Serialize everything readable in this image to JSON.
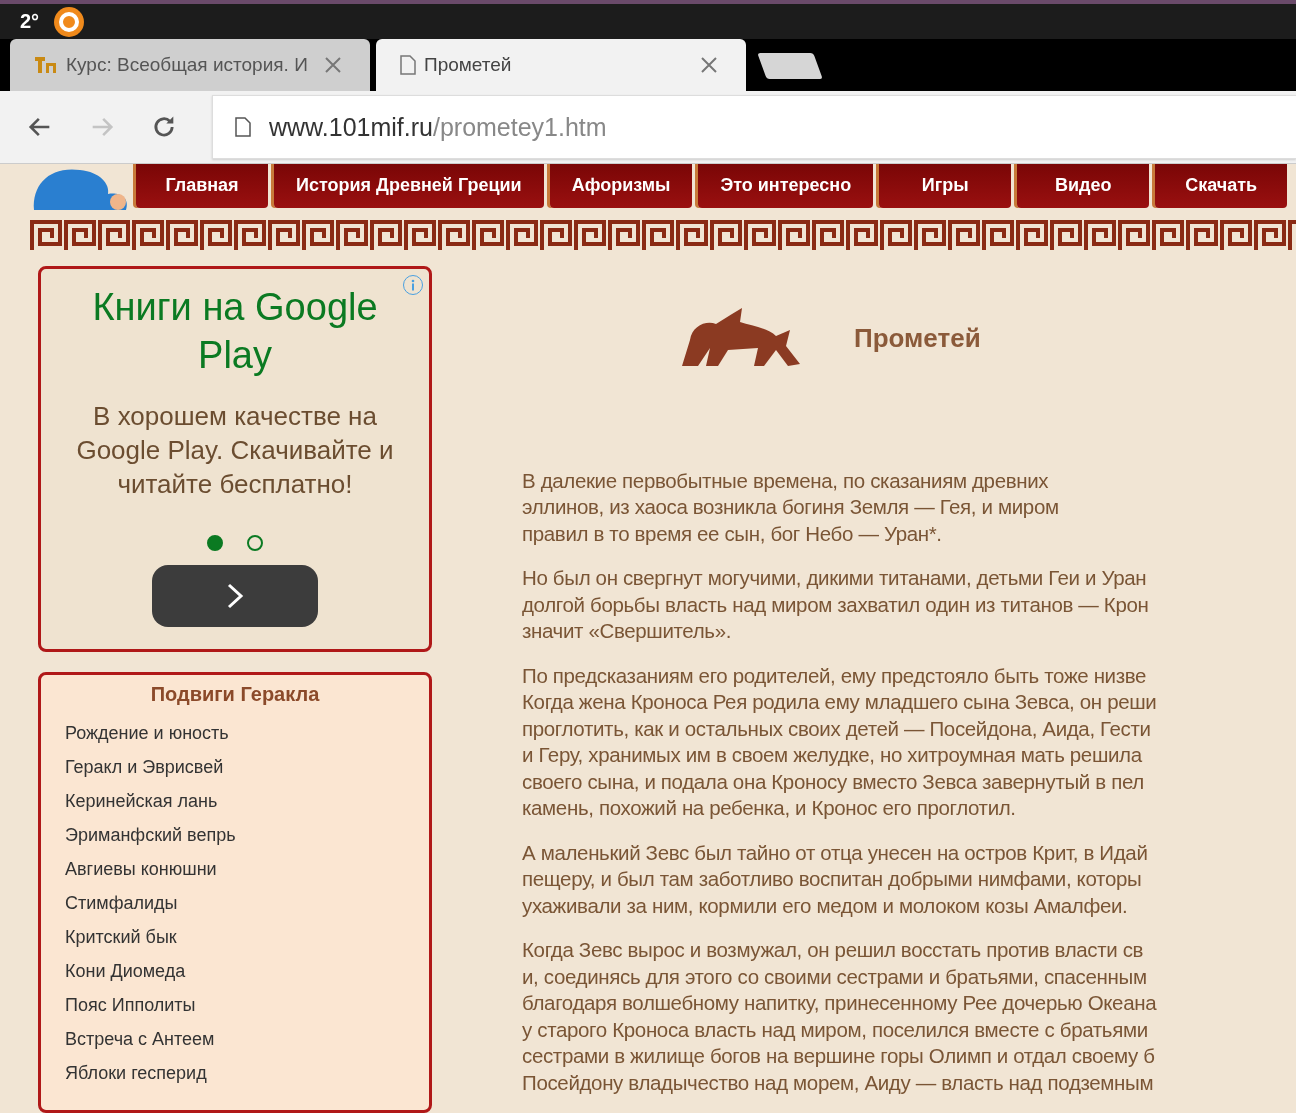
{
  "status_bar": {
    "temperature": "2°"
  },
  "tabs": [
    {
      "title": "Курс: Всеобщая история. И",
      "selected": false,
      "kind": "course"
    },
    {
      "title": "Прометей",
      "selected": true,
      "kind": "page"
    }
  ],
  "toolbar": {
    "back_disabled": false,
    "forward_disabled": true,
    "url_host": "www.101mif.ru",
    "url_path": "/prometey1.htm"
  },
  "nav_menu": [
    "Главная",
    "История Древней Греции",
    "Афоризмы",
    "Это интересно",
    "Игры",
    "Видео",
    "Скачать"
  ],
  "ad": {
    "title": "Книги на Google Play",
    "text": "В хорошем качестве на Google Play. Скачивайте и читайте бесплатно!",
    "dots": [
      {
        "selected": true
      },
      {
        "selected": false
      }
    ]
  },
  "sidebar": {
    "title": "Подвиги Геракла",
    "items": [
      "Рождение и юность",
      "Геракл и Эврисвей",
      "Керинейская лань",
      "Эриманфский вепрь",
      "Авгиевы конюшни",
      "Стимфалиды",
      "Критский бык",
      "Кони Диомеда",
      "Пояс Ипполиты",
      "Встреча с Антеем",
      "Яблоки гесперид"
    ]
  },
  "article": {
    "title": "Прометей",
    "paragraphs": [
      [
        "В далекие первобытные времена, по сказаниям древних",
        "эллинов, из хаоса возникла богиня Земля — Гея, и миром",
        "правил в то время ее сын, бог Небо — Уран*."
      ],
      [
        "Но был он свергнут могучими, дикими титанами, детьми Геи и Уран",
        "долгой борьбы власть над миром захватил один из титанов — Крон",
        "значит «Свершитель»."
      ],
      [
        "По предсказаниям его родителей, ему предстояло быть тоже низве",
        "Когда жена Кроноса Рея родила ему младшего сына Зевса, он реши",
        "проглотить, как и остальных своих детей — Посейдона, Аида, Гести",
        "и Геру, хранимых им в своем желудке, но хитроумная мать решила",
        "своего сына, и подала она Кроносу вместо Зевса завернутый в пел",
        "камень, похожий на ребенка, и Кронос его проглотил."
      ],
      [
        "А маленький Зевс был тайно от отца унесен на остров Крит, в Идай",
        "пещеру, и был там заботливо воспитан добрыми нимфами, которы",
        "ухаживали за ним, кормили его медом и молоком козы Амалфеи."
      ],
      [
        "Когда Зевс вырос и возмужал, он решил восстать против власти св",
        "и, соединясь для этого со своими сестрами и братьями, спасенным",
        "благодаря волшебному напитку, принесенному Рее дочерью Океана",
        "у старого Кроноса власть над миром, поселился вместе с братьями",
        "сестрами в жилище богов на вершине горы Олимп и отдал своему б",
        "Посейдону владычество над морем, Аиду — власть над подземным"
      ]
    ]
  }
}
